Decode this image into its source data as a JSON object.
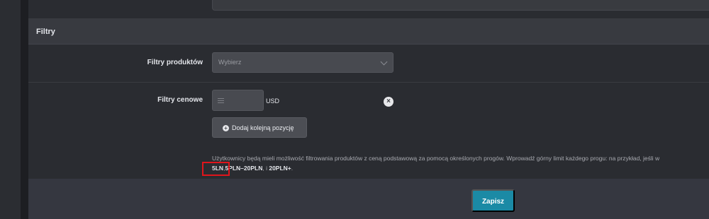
{
  "section": {
    "title": "Filtry"
  },
  "product_filters": {
    "label": "Filtry produktów",
    "select_placeholder": "Wybierz"
  },
  "price_filters": {
    "label": "Filtry cenowe",
    "currency": "USD",
    "add_button_label": "Dodaj kolejną pozycję"
  },
  "help_text": {
    "line1": "Użytkownicy będą mieli możliwość filtrowania produktów z ceną podstawową za pomocą określonych progów. Wprowadź górny limit każdego progu: na przykład, jeśli w",
    "examples": [
      "5LN",
      "5PLN–20PLN",
      "20PLN+"
    ],
    "sep1": ",",
    "sep2": ", i ",
    "end": "."
  },
  "footer": {
    "save_label": "Zapisz"
  },
  "colors": {
    "accent": "#1b8aa5",
    "highlight": "#e0151b",
    "background": "#2a2c31",
    "section_header": "#383a40"
  },
  "icons": {
    "select": "chevron-down-icon",
    "drag": "drag-handle-icon",
    "remove": "close-circle-icon",
    "add": "plus-circle-icon"
  }
}
